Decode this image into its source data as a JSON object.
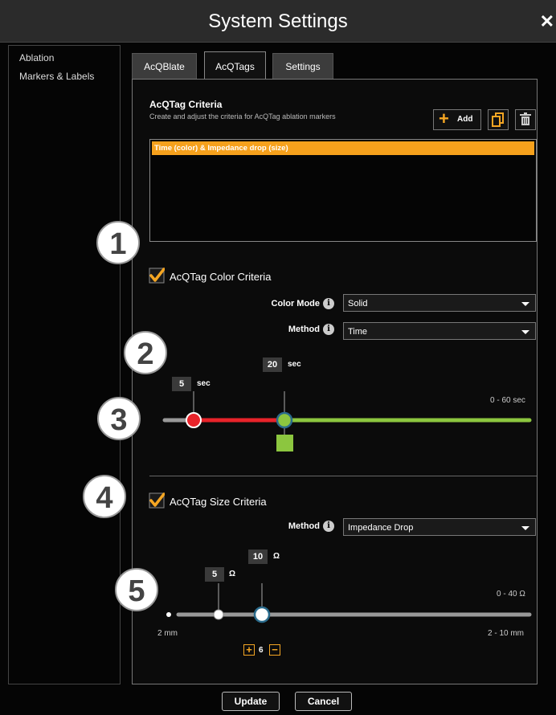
{
  "window": {
    "title": "System Settings",
    "close_glyph": "✕"
  },
  "sidebar": {
    "items": [
      {
        "label": "Ablation"
      },
      {
        "label": "Markers & Labels"
      }
    ]
  },
  "tabs": [
    {
      "label": "AcQBlate"
    },
    {
      "label": "AcQTags",
      "active": true
    },
    {
      "label": "Settings"
    }
  ],
  "criteria": {
    "title": "AcQTag Criteria",
    "subtitle": "Create and adjust the criteria for AcQTag ablation markers",
    "add_label": "Add",
    "copy_icon": "copy-icon",
    "delete_icon": "trash-icon",
    "list": [
      "Time (color) & Impedance drop (size)"
    ]
  },
  "color_criteria": {
    "label": "AcQTag Color Criteria",
    "checked": true,
    "color_mode_label": "Color Mode",
    "color_mode_value": "Solid",
    "method_label": "Method",
    "method_value": "Time",
    "slider": {
      "low_value": "5",
      "low_unit": "sec",
      "high_value": "20",
      "high_unit": "sec",
      "range_label": "0 - 60 sec",
      "min": 0,
      "max": 60,
      "low": 5,
      "high": 20,
      "colors": {
        "low": "#e8232a",
        "high": "#8cc63f",
        "base": "#999999"
      }
    }
  },
  "size_criteria": {
    "label": "AcQTag Size Criteria",
    "checked": true,
    "method_label": "Method",
    "method_value": "Impedance Drop",
    "slider": {
      "low_value": "5",
      "low_unit": "Ω",
      "high_value": "10",
      "high_unit": "Ω",
      "range_label": "0 - 40 Ω",
      "min_size_label": "2 mm",
      "size_range_label": "2 - 10 mm",
      "stepper_value": "6",
      "min": 0,
      "max": 40,
      "low": 5,
      "high": 10
    }
  },
  "callouts": [
    "1",
    "2",
    "3",
    "4",
    "5"
  ],
  "footer": {
    "update_label": "Update",
    "cancel_label": "Cancel"
  },
  "colors": {
    "accent": "#f5a623",
    "selection": "#f6a11c"
  }
}
